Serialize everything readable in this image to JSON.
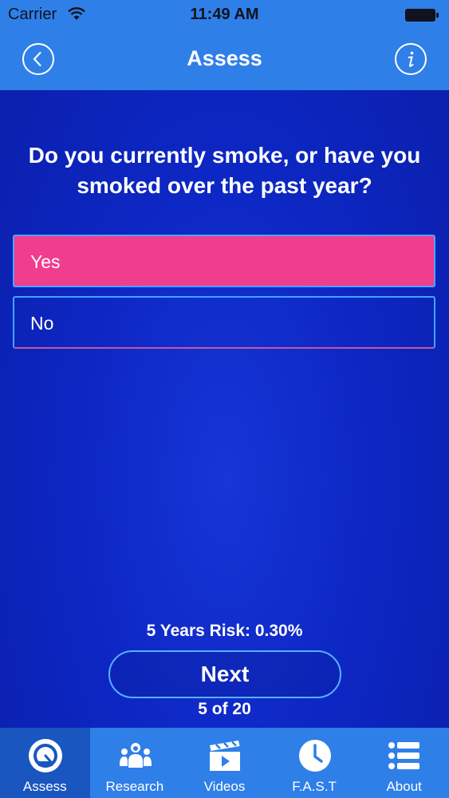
{
  "status_bar": {
    "carrier": "Carrier",
    "time": "11:49 AM"
  },
  "nav": {
    "title": "Assess",
    "back_icon": "chevron-left-circle-icon",
    "info_icon": "info-circle-icon"
  },
  "question": {
    "text": "Do you currently smoke, or have you smoked over the past year?",
    "options": [
      {
        "label": "Yes",
        "selected": true
      },
      {
        "label": "No",
        "selected": false
      }
    ]
  },
  "risk_text": "5 Years Risk: 0.30%",
  "next_label": "Next",
  "progress_text": "5 of 20",
  "tabs": [
    {
      "label": "Assess",
      "icon": "gauge-icon",
      "active": true
    },
    {
      "label": "Research",
      "icon": "people-icon",
      "active": false
    },
    {
      "label": "Videos",
      "icon": "clapperboard-icon",
      "active": false
    },
    {
      "label": "F.A.S.T",
      "icon": "clock-icon",
      "active": false
    },
    {
      "label": "About",
      "icon": "list-icon",
      "active": false
    }
  ],
  "colors": {
    "bar": "#2f7fe8",
    "background": "#0d27c4",
    "selected_option": "#f03d8e",
    "active_tab": "#1a56c0"
  }
}
